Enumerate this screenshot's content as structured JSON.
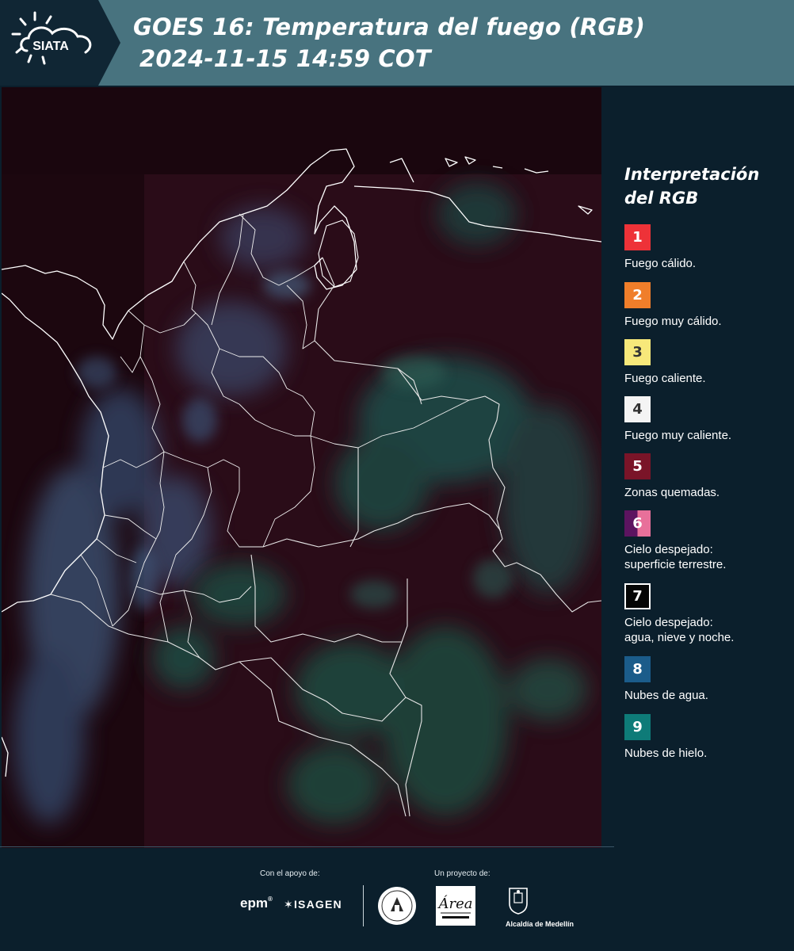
{
  "header": {
    "logo_text": "SIATA",
    "title_line1": "GOES 16: Temperatura del fuego (RGB)",
    "title_line2": "2024-11-15 14:59 COT"
  },
  "legend": {
    "title": "Interpretación del RGB",
    "items": [
      {
        "number": "1",
        "label": "Fuego cálido.",
        "color": "#ee3238"
      },
      {
        "number": "2",
        "label": "Fuego muy cálido.",
        "color": "#f07e2a"
      },
      {
        "number": "3",
        "label": "Fuego caliente.",
        "color": "#f7e87a"
      },
      {
        "number": "4",
        "label": "Fuego muy caliente.",
        "color": "#f4f4f4"
      },
      {
        "number": "5",
        "label": "Zonas quemadas.",
        "color": "#7a1428"
      },
      {
        "number": "6",
        "label": "Cielo despejado:",
        "label2": "superficie terrestre.",
        "color": "#5c1460",
        "color2": "#e8709a"
      },
      {
        "number": "7",
        "label": "Cielo despejado:",
        "label2": "agua, nieve y noche.",
        "color": "#050505"
      },
      {
        "number": "8",
        "label": "Nubes de agua.",
        "color": "#1b5c8a"
      },
      {
        "number": "9",
        "label": "Nubes de hielo.",
        "color": "#0e7b78"
      }
    ]
  },
  "footer": {
    "support_label": "Con el apoyo de:",
    "project_label": "Un proyecto de:",
    "sponsor1": "epm",
    "sponsor2": "ISAGEN",
    "area_logo_text": "Área",
    "alcaldia_text": "Alcaldía de Medellín"
  }
}
